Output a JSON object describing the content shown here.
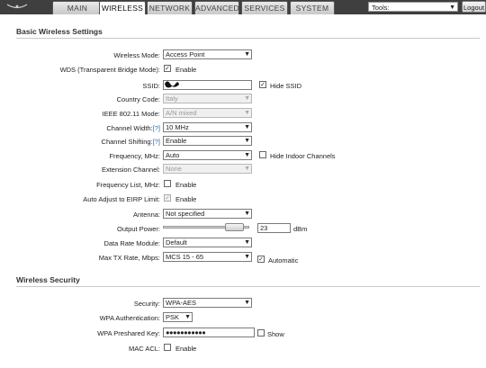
{
  "nav": {
    "logo_icon": "ubiquiti-logo-icon",
    "tabs": [
      {
        "label": "MAIN"
      },
      {
        "label": "WIRELESS"
      },
      {
        "label": "NETWORK"
      },
      {
        "label": "ADVANCED"
      },
      {
        "label": "SERVICES"
      },
      {
        "label": "SYSTEM"
      }
    ],
    "active_tab": "WIRELESS",
    "tools_label": "Tools:",
    "logout_label": "Logout"
  },
  "basic": {
    "title": "Basic Wireless Settings",
    "wireless_mode": {
      "label": "Wireless Mode:",
      "value": "Access Point"
    },
    "wds": {
      "label": "WDS (Transparent Bridge Mode):",
      "checked": true,
      "text": "Enable"
    },
    "ssid": {
      "label": "SSID:",
      "value": "",
      "hide_ssid_text": "Hide SSID",
      "hide_ssid_checked": true
    },
    "country_code": {
      "label": "Country Code:",
      "value": "Italy"
    },
    "ieee_mode": {
      "label": "IEEE 802.11 Mode:",
      "value": "A/N mixed"
    },
    "channel_width": {
      "label": "Channel Width:",
      "help": "[?]",
      "value": "10 MHz"
    },
    "channel_shifting": {
      "label": "Channel Shifting:",
      "help": "[?]",
      "value": "Enable"
    },
    "frequency": {
      "label": "Frequency, MHz:",
      "value": "Auto",
      "hide_indoor_text": "Hide Indoor Channels",
      "hide_indoor_checked": false
    },
    "extension_channel": {
      "label": "Extension Channel:",
      "value": "None"
    },
    "frequency_list": {
      "label": "Frequency List, MHz:",
      "checked": false,
      "text": "Enable"
    },
    "auto_eirp": {
      "label": "Auto Adjust to EIRP Limit:",
      "checked": true,
      "text": "Enable"
    },
    "antenna": {
      "label": "Antenna:",
      "value": "Not specified"
    },
    "output_power": {
      "label": "Output Power:",
      "value": "23",
      "unit": "dBm",
      "level": 0.92
    },
    "data_rate_module": {
      "label": "Data Rate Module:",
      "value": "Default"
    },
    "max_tx_rate": {
      "label": "Max TX Rate, Mbps:",
      "value": "MCS 15 - 65",
      "automatic_text": "Automatic",
      "automatic_checked": true
    }
  },
  "security": {
    "title": "Wireless Security",
    "security": {
      "label": "Security:",
      "value": "WPA-AES"
    },
    "wpa_auth": {
      "label": "WPA Authentication:",
      "value": "PSK"
    },
    "wpa_key": {
      "label": "WPA Preshared Key:",
      "value": "●●●●●●●●●●●",
      "show_text": "Show",
      "show_checked": false
    },
    "mac_acl": {
      "label": "MAC ACL:",
      "checked": false,
      "text": "Enable"
    }
  },
  "colors": {
    "topbar": "#3f3f3f",
    "help_link": "#3366aa",
    "section_line": "#c9c9c9"
  }
}
